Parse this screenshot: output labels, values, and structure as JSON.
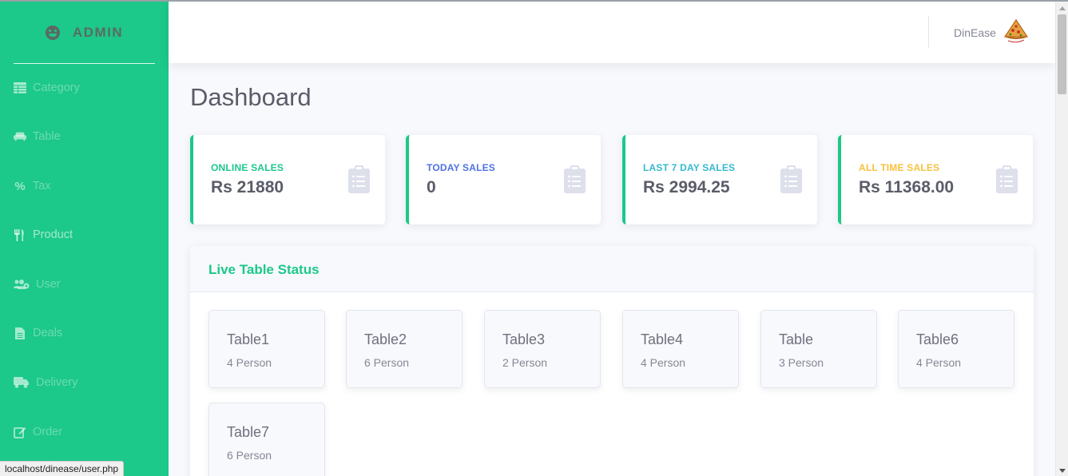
{
  "sidebar": {
    "brand": "ADMIN",
    "items": [
      {
        "label": "Category",
        "icon": "table-icon"
      },
      {
        "label": "Table",
        "icon": "couch-icon"
      },
      {
        "label": "Tax",
        "icon": "percent-icon"
      },
      {
        "label": "Product",
        "icon": "utensils-icon"
      },
      {
        "label": "User",
        "icon": "users-cog-icon"
      },
      {
        "label": "Deals",
        "icon": "file-icon"
      },
      {
        "label": "Delivery",
        "icon": "truck-icon"
      },
      {
        "label": "Order",
        "icon": "edit-icon"
      }
    ]
  },
  "topbar": {
    "user_name": "DinEase"
  },
  "page": {
    "title": "Dashboard"
  },
  "stats": [
    {
      "label": "ONLINE SALES",
      "value": "Rs 21880",
      "color": "#1cc88a"
    },
    {
      "label": "TODAY SALES",
      "value": "0",
      "color": "#4e73df"
    },
    {
      "label": "LAST 7 DAY SALES",
      "value": "Rs 2994.25",
      "color": "#36b9cc"
    },
    {
      "label": "ALL TIME SALES",
      "value": "Rs 11368.00",
      "color": "#f6c23e"
    }
  ],
  "live_panel": {
    "title": "Live Table Status",
    "tables": [
      {
        "name": "Table1",
        "capacity": "4 Person"
      },
      {
        "name": "Table2",
        "capacity": "6 Person"
      },
      {
        "name": "Table3",
        "capacity": "2 Person"
      },
      {
        "name": "Table4",
        "capacity": "4 Person"
      },
      {
        "name": "Table",
        "capacity": "3 Person"
      },
      {
        "name": "Table6",
        "capacity": "4 Person"
      },
      {
        "name": "Table7",
        "capacity": "6 Person"
      }
    ]
  },
  "status_bar": {
    "url": "localhost/dinease/user.php"
  }
}
